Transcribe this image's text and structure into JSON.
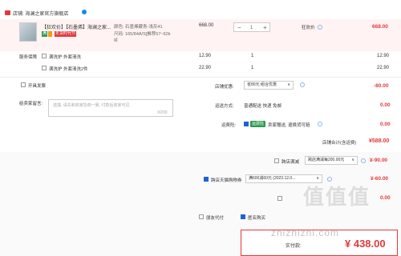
{
  "shop": {
    "name": "店铺: 海澜之家官方旗舰店"
  },
  "product": {
    "title": "【狂欢价】【石墨烯】海澜之家...",
    "tag1": "满",
    "tag2": "年货时代节",
    "color_line": "颜色: 石墨烯藏青-浅灰41",
    "size_line": "尺码: 165/84A/S[推荐57~62k",
    "size_line2": "g]",
    "price": "668.00",
    "qty": "1",
    "promo": "狂欢价",
    "subtotal": "668.00"
  },
  "services": {
    "label": "服务保障",
    "items": [
      {
        "name": "满洗护 外套清洗",
        "price": "12.90",
        "qty": "1",
        "subtotal": "12.90"
      },
      {
        "name": "满洗护 外套清洗2件",
        "price": "22.90",
        "qty": "1",
        "subtotal": "22.90"
      }
    ]
  },
  "invoice": {
    "label": "开具发票"
  },
  "remark": {
    "label": "给卖家留言:",
    "placeholder": "选填, 请先和商家协商一致, 付款后商家可见",
    "counter": "0/200"
  },
  "shop_discount": {
    "label": "店铺优惠:",
    "value": "省80元:组合优惠",
    "amount": "-80.00"
  },
  "shipping": {
    "label": "运送方式:",
    "value": "普通配送 快递 免邮",
    "amount": "0.00"
  },
  "insurance": {
    "label": "运费险:",
    "tag": "运费险",
    "text": "卖家赠送, 退换货可赔",
    "amount": "0.00"
  },
  "shop_total": {
    "label": "店铺合计(含运费)",
    "amount": "¥588.00"
  },
  "cross_store": {
    "label": "跨店满减",
    "value": "跨店满减每200.00元",
    "amount": "¥-90.00"
  },
  "tmall_coupon": {
    "label": "跨店天猫购物券",
    "value": "满600减60元 (2023.12.0...",
    "amount": "¥-60.00"
  },
  "extra_row": {
    "amount": "0.00"
  },
  "options": {
    "anon": "匿名购买",
    "friend": "朋友代付"
  },
  "footer": {
    "pay_label": "实付款:",
    "pay_amount": "¥ 438.00"
  },
  "watermark": {
    "text": "zhizhizhi.com",
    "logo": "值值值"
  }
}
